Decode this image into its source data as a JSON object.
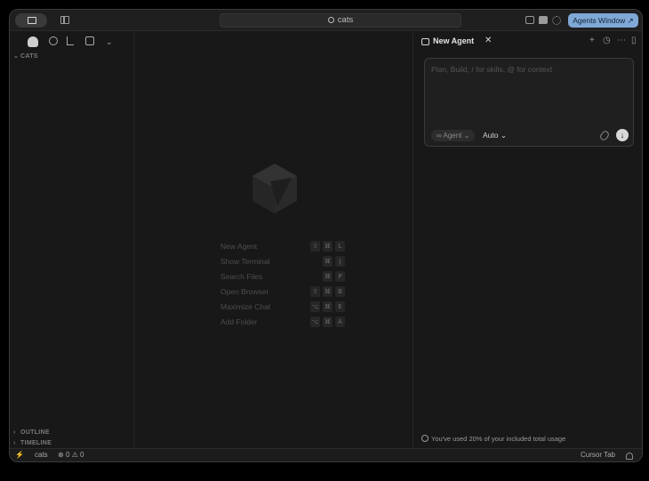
{
  "titlebar": {
    "search_text": "cats",
    "agents_window_label": "Agents Window ↗"
  },
  "sidebar": {
    "folder_header": "CATS",
    "outline_header": "OUTLINE",
    "timeline_header": "TIMELINE"
  },
  "editor": {
    "shortcuts": [
      {
        "label": "New Agent",
        "keys": [
          "⇧",
          "⌘",
          "L"
        ]
      },
      {
        "label": "Show Terminal",
        "keys": [
          "⌘",
          "J"
        ]
      },
      {
        "label": "Search Files",
        "keys": [
          "⌘",
          "P"
        ]
      },
      {
        "label": "Open Browser",
        "keys": [
          "⇧",
          "⌘",
          "B"
        ]
      },
      {
        "label": "Maximize Chat",
        "keys": [
          "⌥",
          "⌘",
          "E"
        ]
      },
      {
        "label": "Add Folder",
        "keys": [
          "⌥",
          "⌘",
          "A"
        ]
      }
    ]
  },
  "agent": {
    "tab_title": "New Agent",
    "placeholder": "Plan, Build, / for skills, @ for context",
    "mode_label": "∞ Agent",
    "model_label": "Auto",
    "usage_text": "You've used 20% of your included total usage"
  },
  "statusbar": {
    "branch": "cats",
    "errors": "0",
    "warnings": "0",
    "cursor_tab": "Cursor Tab"
  },
  "colors": {
    "accent": "#7fa8d6",
    "background": "#181818"
  }
}
